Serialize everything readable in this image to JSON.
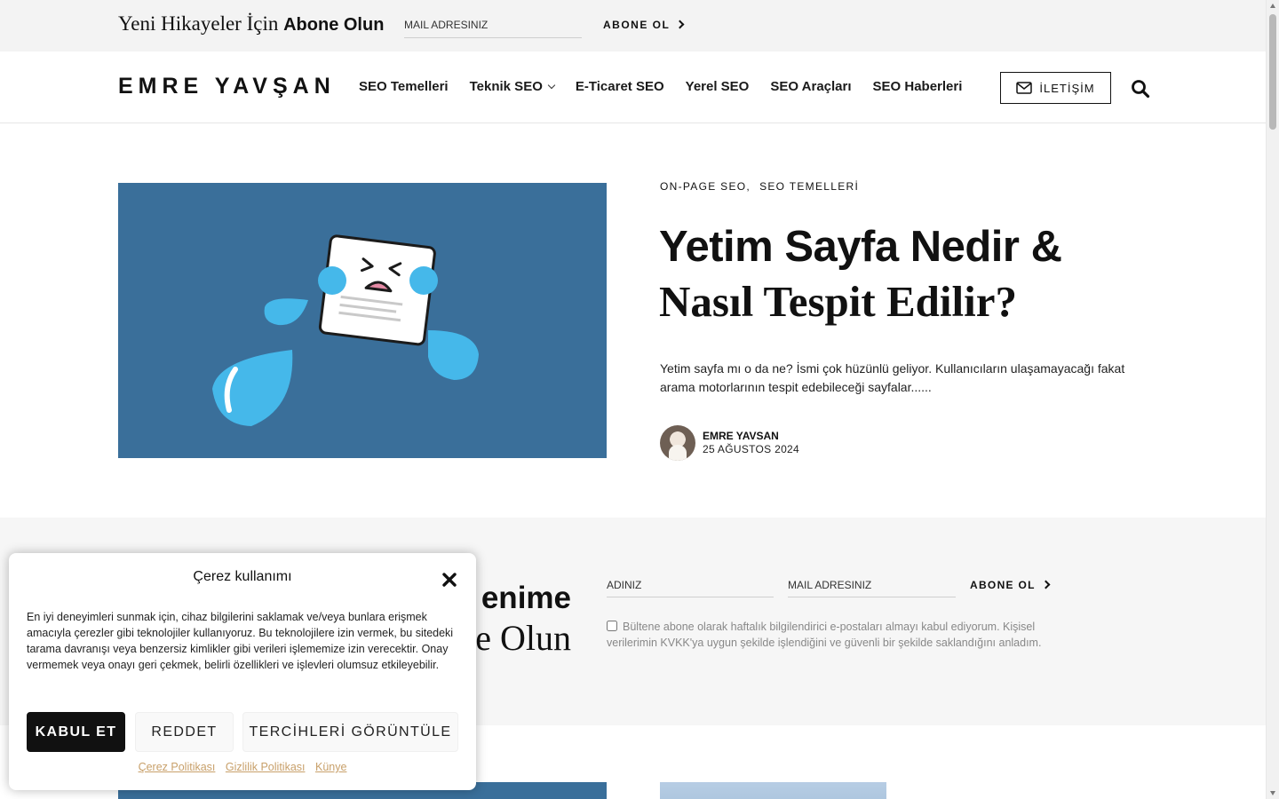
{
  "topbar": {
    "lead_text": "Yeni Hikayeler İçin",
    "lead_bold": "Abone Olun",
    "mail_placeholder": "MAIL ADRESINIZ",
    "subscribe_label": "ABONE OL"
  },
  "header": {
    "logo": "EMRE YAVŞAN",
    "nav": [
      {
        "label": "SEO Temelleri"
      },
      {
        "label": "Teknik SEO"
      },
      {
        "label": "E-Ticaret SEO"
      },
      {
        "label": "Yerel SEO"
      },
      {
        "label": "SEO Araçları"
      },
      {
        "label": "SEO Haberleri"
      }
    ],
    "contact_label": "İLETİŞİM",
    "icons": {
      "contact": "mail-icon",
      "search": "search-icon",
      "dropdown": "chevron-down-icon"
    }
  },
  "hero": {
    "categories": [
      "ON-PAGE SEO,",
      "SEO TEMELLERİ"
    ],
    "title_line1": "Yetim Sayfa Nedir &",
    "title_line2": "Nasıl Tespit Edilir?",
    "excerpt": "Yetim sayfa mı o da ne? İsmi çok hüzünlü geliyor. Kullanıcıların ulaşamayacağı fakat arama motorlarının tespit edebileceği sayfalar......",
    "author": "EMRE YAVSAN",
    "date": "25 AĞUSTOS 2024"
  },
  "newsletter": {
    "heading_line1": "enime",
    "heading_line2": "e Olun",
    "name_placeholder": "ADINIZ",
    "mail_placeholder": "MAIL ADRESINIZ",
    "subscribe_label": "ABONE OL",
    "consent_text": "Bültene abone olarak haftalık bilgilendirici e-postaları almayı kabul ediyorum. Kişisel verilerimin KVKK'ya uygun şekilde işlendiğini ve güvenli bir şekilde saklandığını anladım."
  },
  "cookie": {
    "title": "Çerez kullanımı",
    "text": "En iyi deneyimleri sunmak için, cihaz bilgilerini saklamak ve/veya bunlara erişmek amacıyla çerezler gibi teknolojiler kullanıyoruz. Bu teknolojilere izin vermek, bu sitedeki tarama davranışı veya benzersiz kimlikler gibi verileri işlememize izin verecektir. Onay vermemek veya onayı geri çekmek, belirli özellikleri ve işlevleri olumsuz etkileyebilir.",
    "accept_label": "KABUL ET",
    "deny_label": "REDDET",
    "prefs_label": "TERCİHLERİ GÖRÜNTÜLE",
    "links": [
      "Çerez Politikası",
      "Gizlilik Politikası",
      "Künye"
    ]
  },
  "colors": {
    "hero_bg": "#3a6f9a",
    "drop": "#45b8ea",
    "band_bg": "#f6f6f6",
    "link": "#c8a06a"
  }
}
